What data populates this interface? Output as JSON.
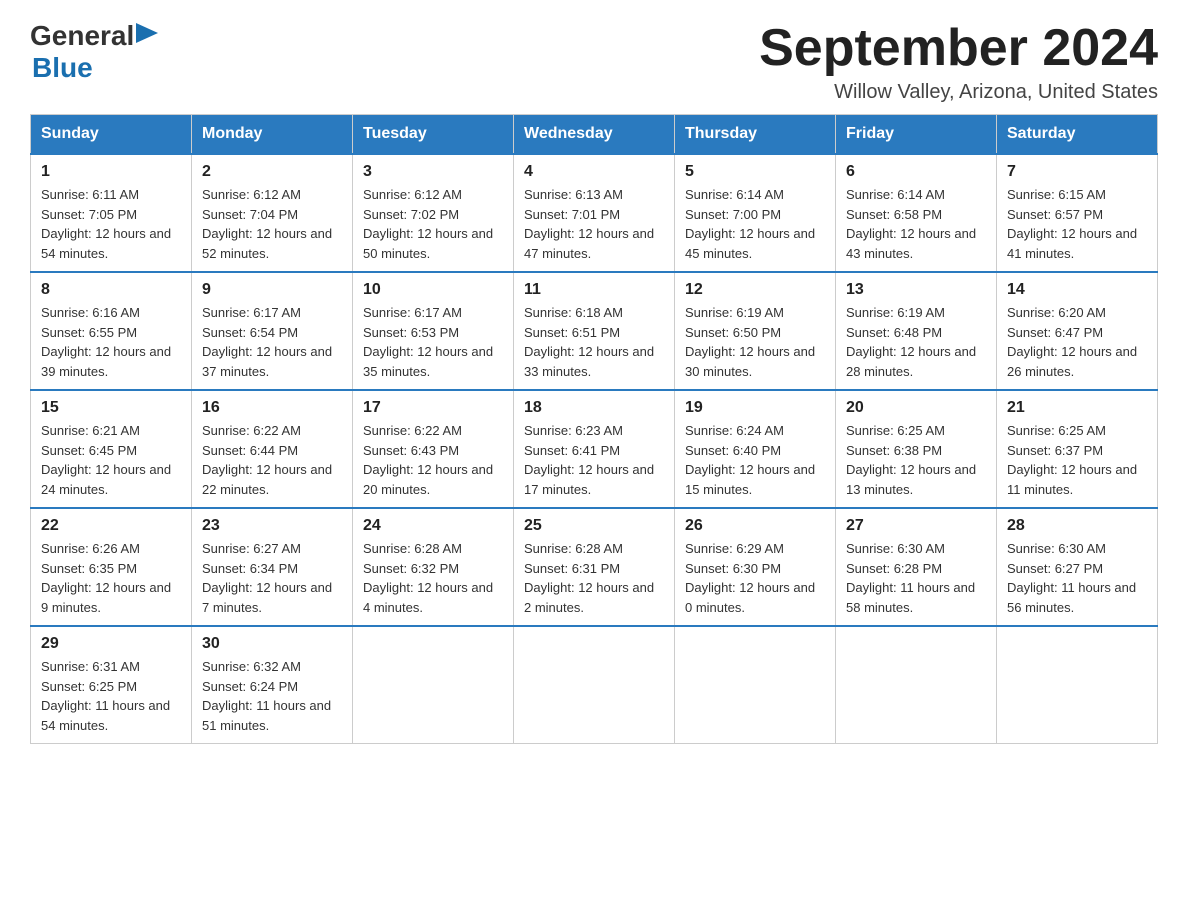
{
  "header": {
    "logo": {
      "text_general": "General",
      "triangle_symbol": "▶",
      "text_blue": "Blue"
    },
    "title": "September 2024",
    "subtitle": "Willow Valley, Arizona, United States"
  },
  "weekdays": [
    "Sunday",
    "Monday",
    "Tuesday",
    "Wednesday",
    "Thursday",
    "Friday",
    "Saturday"
  ],
  "weeks": [
    [
      {
        "day": "1",
        "sunrise": "6:11 AM",
        "sunset": "7:05 PM",
        "daylight": "12 hours and 54 minutes."
      },
      {
        "day": "2",
        "sunrise": "6:12 AM",
        "sunset": "7:04 PM",
        "daylight": "12 hours and 52 minutes."
      },
      {
        "day": "3",
        "sunrise": "6:12 AM",
        "sunset": "7:02 PM",
        "daylight": "12 hours and 50 minutes."
      },
      {
        "day": "4",
        "sunrise": "6:13 AM",
        "sunset": "7:01 PM",
        "daylight": "12 hours and 47 minutes."
      },
      {
        "day": "5",
        "sunrise": "6:14 AM",
        "sunset": "7:00 PM",
        "daylight": "12 hours and 45 minutes."
      },
      {
        "day": "6",
        "sunrise": "6:14 AM",
        "sunset": "6:58 PM",
        "daylight": "12 hours and 43 minutes."
      },
      {
        "day": "7",
        "sunrise": "6:15 AM",
        "sunset": "6:57 PM",
        "daylight": "12 hours and 41 minutes."
      }
    ],
    [
      {
        "day": "8",
        "sunrise": "6:16 AM",
        "sunset": "6:55 PM",
        "daylight": "12 hours and 39 minutes."
      },
      {
        "day": "9",
        "sunrise": "6:17 AM",
        "sunset": "6:54 PM",
        "daylight": "12 hours and 37 minutes."
      },
      {
        "day": "10",
        "sunrise": "6:17 AM",
        "sunset": "6:53 PM",
        "daylight": "12 hours and 35 minutes."
      },
      {
        "day": "11",
        "sunrise": "6:18 AM",
        "sunset": "6:51 PM",
        "daylight": "12 hours and 33 minutes."
      },
      {
        "day": "12",
        "sunrise": "6:19 AM",
        "sunset": "6:50 PM",
        "daylight": "12 hours and 30 minutes."
      },
      {
        "day": "13",
        "sunrise": "6:19 AM",
        "sunset": "6:48 PM",
        "daylight": "12 hours and 28 minutes."
      },
      {
        "day": "14",
        "sunrise": "6:20 AM",
        "sunset": "6:47 PM",
        "daylight": "12 hours and 26 minutes."
      }
    ],
    [
      {
        "day": "15",
        "sunrise": "6:21 AM",
        "sunset": "6:45 PM",
        "daylight": "12 hours and 24 minutes."
      },
      {
        "day": "16",
        "sunrise": "6:22 AM",
        "sunset": "6:44 PM",
        "daylight": "12 hours and 22 minutes."
      },
      {
        "day": "17",
        "sunrise": "6:22 AM",
        "sunset": "6:43 PM",
        "daylight": "12 hours and 20 minutes."
      },
      {
        "day": "18",
        "sunrise": "6:23 AM",
        "sunset": "6:41 PM",
        "daylight": "12 hours and 17 minutes."
      },
      {
        "day": "19",
        "sunrise": "6:24 AM",
        "sunset": "6:40 PM",
        "daylight": "12 hours and 15 minutes."
      },
      {
        "day": "20",
        "sunrise": "6:25 AM",
        "sunset": "6:38 PM",
        "daylight": "12 hours and 13 minutes."
      },
      {
        "day": "21",
        "sunrise": "6:25 AM",
        "sunset": "6:37 PM",
        "daylight": "12 hours and 11 minutes."
      }
    ],
    [
      {
        "day": "22",
        "sunrise": "6:26 AM",
        "sunset": "6:35 PM",
        "daylight": "12 hours and 9 minutes."
      },
      {
        "day": "23",
        "sunrise": "6:27 AM",
        "sunset": "6:34 PM",
        "daylight": "12 hours and 7 minutes."
      },
      {
        "day": "24",
        "sunrise": "6:28 AM",
        "sunset": "6:32 PM",
        "daylight": "12 hours and 4 minutes."
      },
      {
        "day": "25",
        "sunrise": "6:28 AM",
        "sunset": "6:31 PM",
        "daylight": "12 hours and 2 minutes."
      },
      {
        "day": "26",
        "sunrise": "6:29 AM",
        "sunset": "6:30 PM",
        "daylight": "12 hours and 0 minutes."
      },
      {
        "day": "27",
        "sunrise": "6:30 AM",
        "sunset": "6:28 PM",
        "daylight": "11 hours and 58 minutes."
      },
      {
        "day": "28",
        "sunrise": "6:30 AM",
        "sunset": "6:27 PM",
        "daylight": "11 hours and 56 minutes."
      }
    ],
    [
      {
        "day": "29",
        "sunrise": "6:31 AM",
        "sunset": "6:25 PM",
        "daylight": "11 hours and 54 minutes."
      },
      {
        "day": "30",
        "sunrise": "6:32 AM",
        "sunset": "6:24 PM",
        "daylight": "11 hours and 51 minutes."
      },
      null,
      null,
      null,
      null,
      null
    ]
  ],
  "labels": {
    "sunrise_prefix": "Sunrise: ",
    "sunset_prefix": "Sunset: ",
    "daylight_prefix": "Daylight: "
  }
}
